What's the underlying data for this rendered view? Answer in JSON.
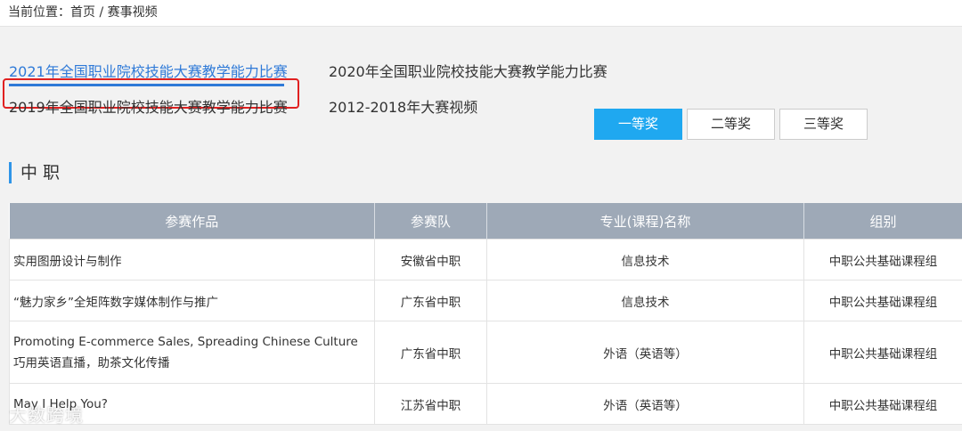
{
  "breadcrumb": {
    "label": "当前位置：",
    "home": "首页",
    "separator": " / ",
    "current": "赛事视频"
  },
  "tabs": [
    {
      "label": "2021年全国职业院校技能大赛教学能力比赛",
      "active": true
    },
    {
      "label": "2020年全国职业院校技能大赛教学能力比赛",
      "active": false
    },
    {
      "label": "2019年全国职业院校技能大赛教学能力比赛",
      "active": false
    },
    {
      "label": "2012-2018年大赛视频",
      "active": false
    }
  ],
  "awards": [
    {
      "label": "一等奖",
      "active": true
    },
    {
      "label": "二等奖",
      "active": false
    },
    {
      "label": "三等奖",
      "active": false
    }
  ],
  "section": {
    "title": "中职"
  },
  "table": {
    "headers": [
      "参赛作品",
      "参赛队",
      "专业(课程)名称",
      "组别"
    ],
    "rows": [
      [
        "实用图册设计与制作",
        "安徽省中职",
        "信息技术",
        "中职公共基础课程组"
      ],
      [
        "“魅力家乡”全矩阵数字媒体制作与推广",
        "广东省中职",
        "信息技术",
        "中职公共基础课程组"
      ],
      [
        "Promoting E-commerce Sales, Spreading Chinese Culture 巧用英语直播，助茶文化传播",
        "广东省中职",
        "外语（英语等）",
        "中职公共基础课程组"
      ],
      [
        "May I Help You?",
        "江苏省中职",
        "外语（英语等）",
        "中职公共基础课程组"
      ]
    ]
  },
  "colors": {
    "accent": "#2f7ad8",
    "active_button": "#1fa8f0",
    "header_bg": "#9ea9b7",
    "highlight_box": "#e02020"
  },
  "watermark": "大数跨境"
}
